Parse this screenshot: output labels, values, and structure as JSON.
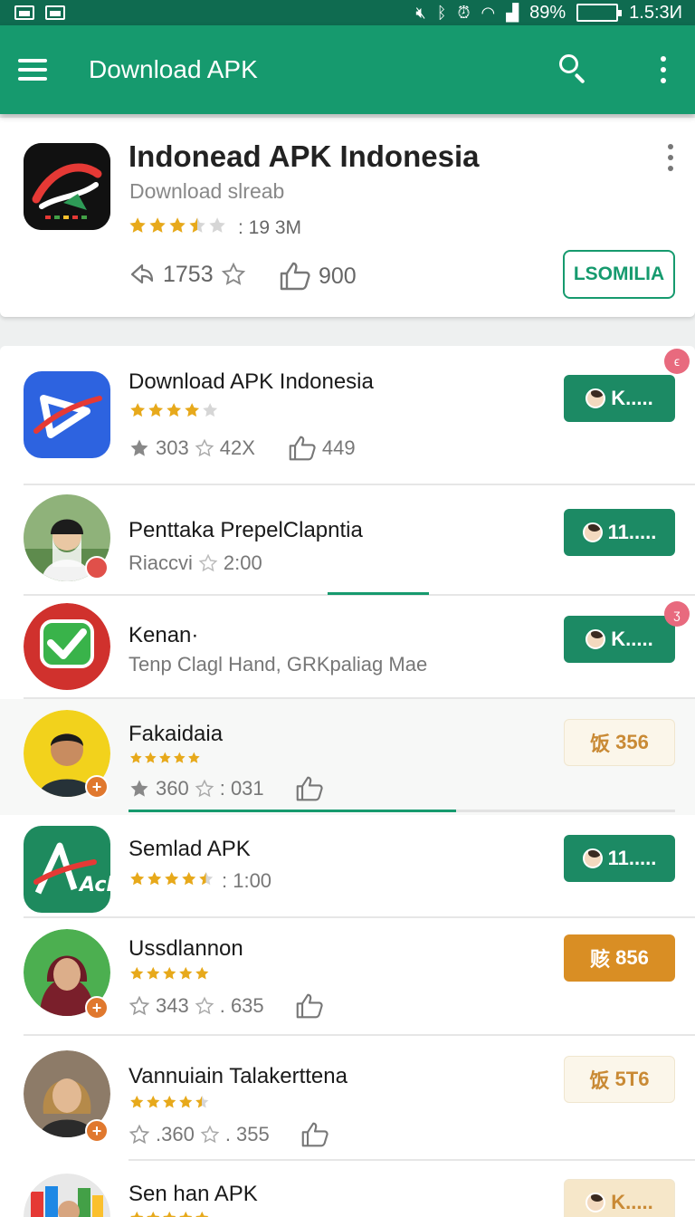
{
  "status_bar": {
    "battery": "89%",
    "time": "1.5:3И"
  },
  "app_bar": {
    "title": "Download APK"
  },
  "hero": {
    "title": "Indonead APK Indonesia",
    "subtitle": "Download slreab",
    "rating_stars": 3.5,
    "size": ": 19 3M",
    "stat_1": "1753",
    "stat_2": "900",
    "button_label": "LSOMILIA",
    "accent": "#169a6e"
  },
  "rows": [
    {
      "title": "Download APK Indonesia",
      "rating_stars": 4,
      "meta_1": "303",
      "meta_2": "42X",
      "meta_3": "449",
      "button_label": "K.....",
      "button_style": "green",
      "badge": "ϵ"
    },
    {
      "title": "Penttaka PrepelClapntia",
      "meta_1": "Riaccvi",
      "meta_2": "2:00",
      "button_label": "11.....",
      "button_style": "green",
      "progress": 0.3
    },
    {
      "title": "Kenan·",
      "meta_1": "Tenp Clagl Hand, GRKpaliag Mae",
      "button_label": "K.....",
      "button_style": "green",
      "badge": "ʒ"
    },
    {
      "title": "Fakaidaia",
      "rating_stars": 5,
      "meta_1": "360",
      "meta_2": ": 031",
      "button_label": "356",
      "button_style": "pale",
      "progress": 0.6
    },
    {
      "title": "Semlad APK",
      "rating_stars": 4.5,
      "meta_1": ": 1:00",
      "button_label": "11.....",
      "button_style": "green"
    },
    {
      "title": "Ussdlannon",
      "rating_stars": 5,
      "meta_1": "343",
      "meta_2": ". 635",
      "button_label": "856",
      "button_style": "orange"
    },
    {
      "title": "Vannuiain Talakerttena",
      "rating_stars": 4.5,
      "meta_1": ".360",
      "meta_2": ". 355",
      "button_label": "5T6",
      "button_style": "pale"
    },
    {
      "title": "Sen han APK",
      "rating_stars": 5,
      "button_label": "K.....",
      "button_style": "pale"
    }
  ]
}
